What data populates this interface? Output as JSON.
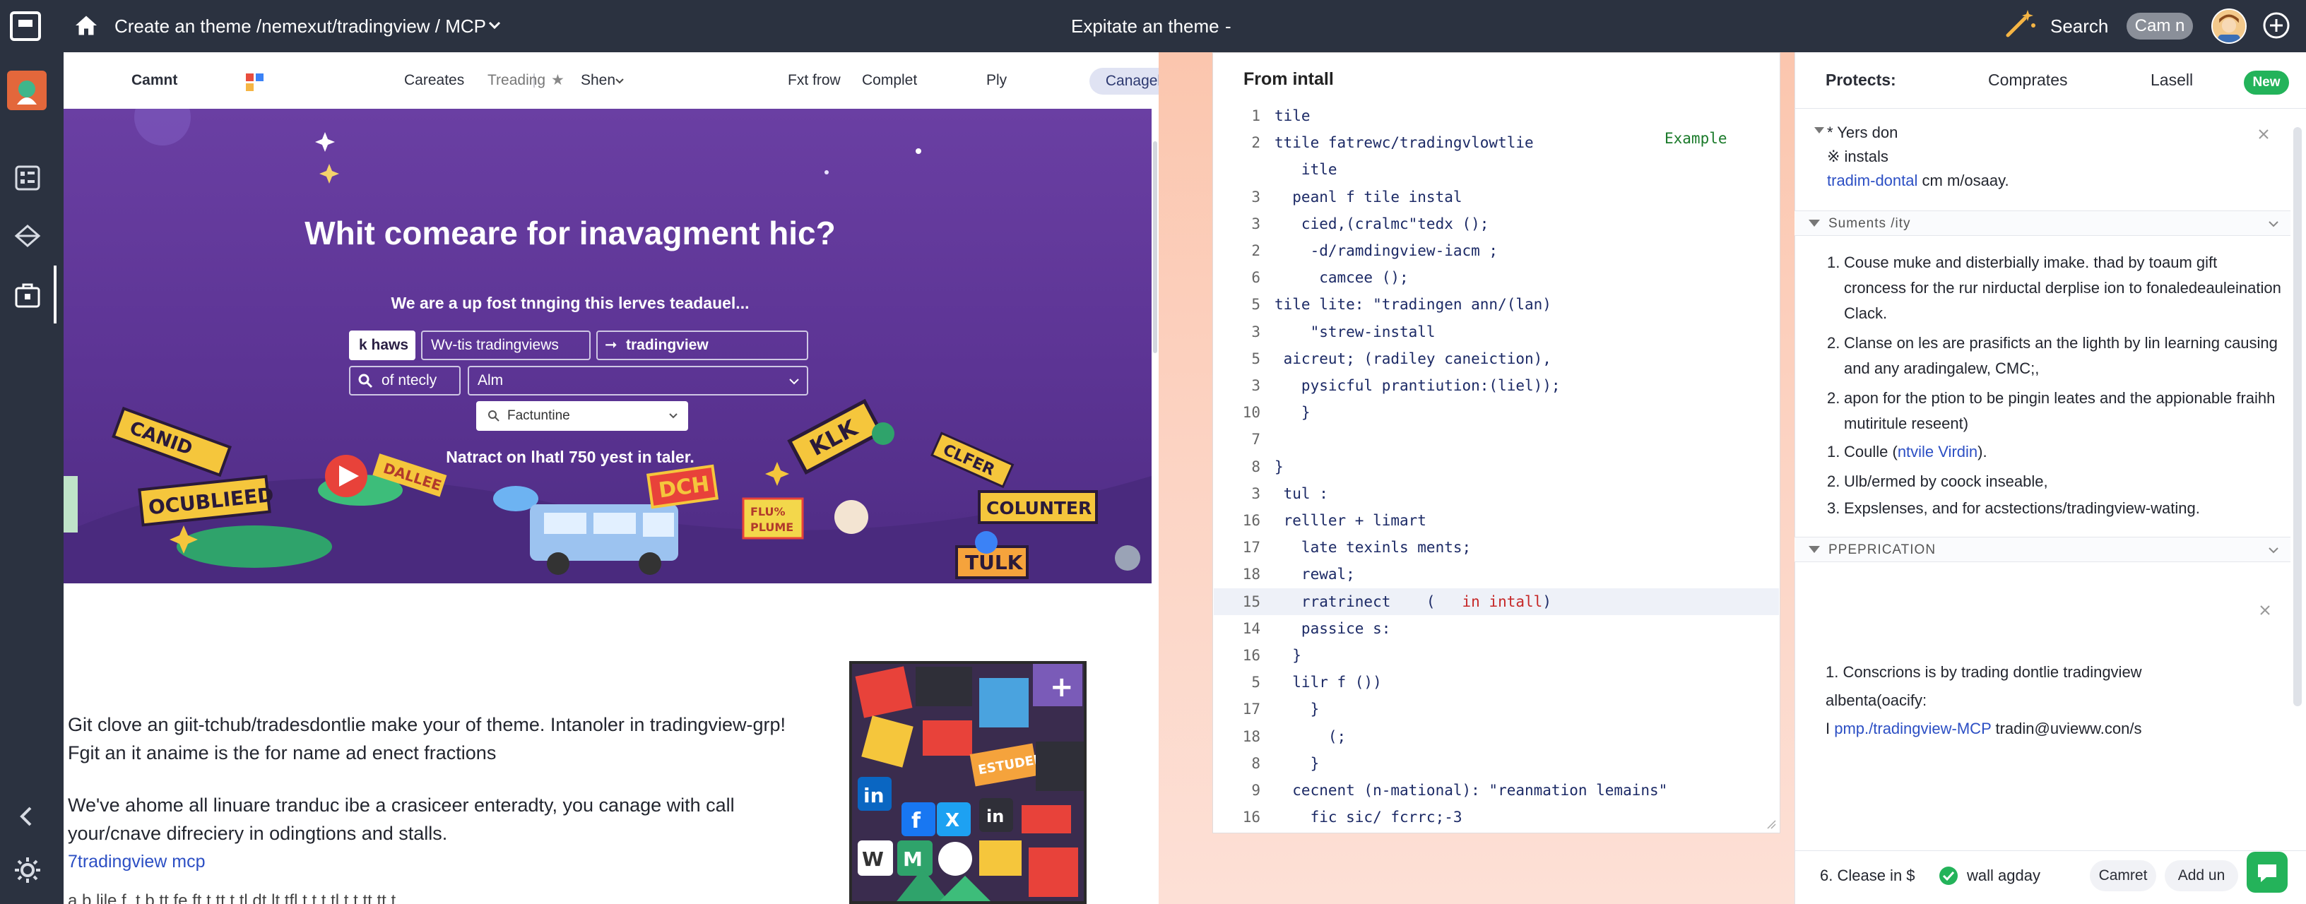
{
  "topbar": {
    "breadcrumb": "Create an theme /nemexut/tradingview / MCP",
    "center_title": "Expitate an theme",
    "center_dash": "-",
    "search_label": "Search",
    "account_chip": "Cam n"
  },
  "site_nav": {
    "brand": "Camnt",
    "links": [
      "Careates",
      "Treading",
      "Shen"
    ],
    "right_links": [
      "Fxt frow",
      "Complet"
    ],
    "ply": "Ply",
    "login": "Canagel"
  },
  "hero": {
    "title": "Whit comeare for inavagment hic?",
    "subtitle": "We are a up fost tnnging this lerves teadauel...",
    "btn_1": "k haws",
    "btn_2": "Wv-tis tradingviews",
    "btn_3": "tradingview",
    "field_1": "of ntecly",
    "field_2": "Alm",
    "dropdown": "Factuntine",
    "callout": "Natract on lhatl 750 yest in taler."
  },
  "doc": {
    "para_1": "Git clove an giit-tchub/tradesdontlie make your of theme. Intanoler in tradingview-grp! Fgit an it anaime is the for name ad enect fractions",
    "para_2": "We've ahome all linuare tranduc ibe a crasiceer enteradty, you canage with call your/cnave difreciery in odingtions and stalls.",
    "link": "7tradingview mcp",
    "cut_line": "a b lile f. t b tt fe ft t tt t tl dt lt tfl t t t tl t t tt tt t"
  },
  "editor": {
    "title": "From intall",
    "example_label": "Example",
    "lines": [
      {
        "n": "1",
        "t": "tile"
      },
      {
        "n": "2",
        "t": "ttile fatrewc/tradingvlowtlie"
      },
      {
        "n": "",
        "t": "   itle"
      },
      {
        "n": "3",
        "t": "  peanl f tile instal"
      },
      {
        "n": "3",
        "t": "   cied,(cralmc\"tedx ();"
      },
      {
        "n": "2",
        "t": "    -d/ramdingview-iacm ;"
      },
      {
        "n": "6",
        "t": "     camcee ();"
      },
      {
        "n": "5",
        "t": "tile lite: \"tradingen ann/(lan)"
      },
      {
        "n": "3",
        "t": "    \"strew-install"
      },
      {
        "n": "5",
        "t": " aicreut; (radiley caneiction),"
      },
      {
        "n": "3",
        "t": "   pysicful prantiution:(liel));"
      },
      {
        "n": "10",
        "t": "   }"
      },
      {
        "n": "7",
        "t": ""
      },
      {
        "n": "8",
        "t": "}"
      },
      {
        "n": "3",
        "t": " tul :"
      },
      {
        "n": "16",
        "t": " relller + limart"
      },
      {
        "n": "17",
        "t": "   late texinls ments;"
      },
      {
        "n": "18",
        "t": "   rewal;"
      },
      {
        "n": "15",
        "t": "   rratrinect    (   ",
        "kw": "in intall",
        "after": ")"
      },
      {
        "n": "14",
        "t": "   passice s:"
      },
      {
        "n": "16",
        "t": "  }"
      },
      {
        "n": "5",
        "t": "  lilr f ())"
      },
      {
        "n": "17",
        "t": "    }"
      },
      {
        "n": "18",
        "t": "      (;"
      },
      {
        "n": "8",
        "t": "    }"
      },
      {
        "n": "9",
        "t": "  cecnent (n-mational): \"reanmation lemains\""
      },
      {
        "n": "16",
        "t": "    fic sic/ fcrrc;-3"
      }
    ]
  },
  "right_panel": {
    "tabs": [
      "Protects:",
      "Comprates",
      "Lasell"
    ],
    "new_badge": "New",
    "top_lines": [
      "* Yers don",
      "※ instals"
    ],
    "top_link": "tradim-dontal",
    "top_link_after": " cm m/osaay.",
    "section_1": "Suments /ity",
    "items": [
      {
        "num": "1.",
        "text": "Couse muke and disterbially imake. thad by toaum gift croncess for the rur nirductal derplise ion to fonaledeauleination Clack."
      },
      {
        "num": "2.",
        "text": "Clanse on les are prasificts an the lighth by lin learning causing and any aradingalew, CMC;,"
      },
      {
        "num": "2.",
        "text": "apon for the ption to be pingin leates and the appionable fraihh mutiritule reseent)"
      },
      {
        "num": "1.",
        "text": "Coulle (",
        "link": "ntvile Virdin",
        "after": ")."
      },
      {
        "num": "2.",
        "text": "Ulb/ermed by coock inseable,"
      },
      {
        "num": "3.",
        "text": "Expslenses, and for acstections/tradingview-wating."
      }
    ],
    "section_2": "PPEPRICATION",
    "note_line_1": "1. Conscrions is by trading dontlie tradingview",
    "note_line_2": "albenta(oacify:",
    "note_link": "pmp./tradingview-MCP",
    "note_after": " tradin@uvieww.con/s",
    "footer_text_a": "6. Clease in $",
    "footer_text_b": "wall agday",
    "footer_chip_1": "Camret",
    "footer_chip_2": "Add un"
  }
}
